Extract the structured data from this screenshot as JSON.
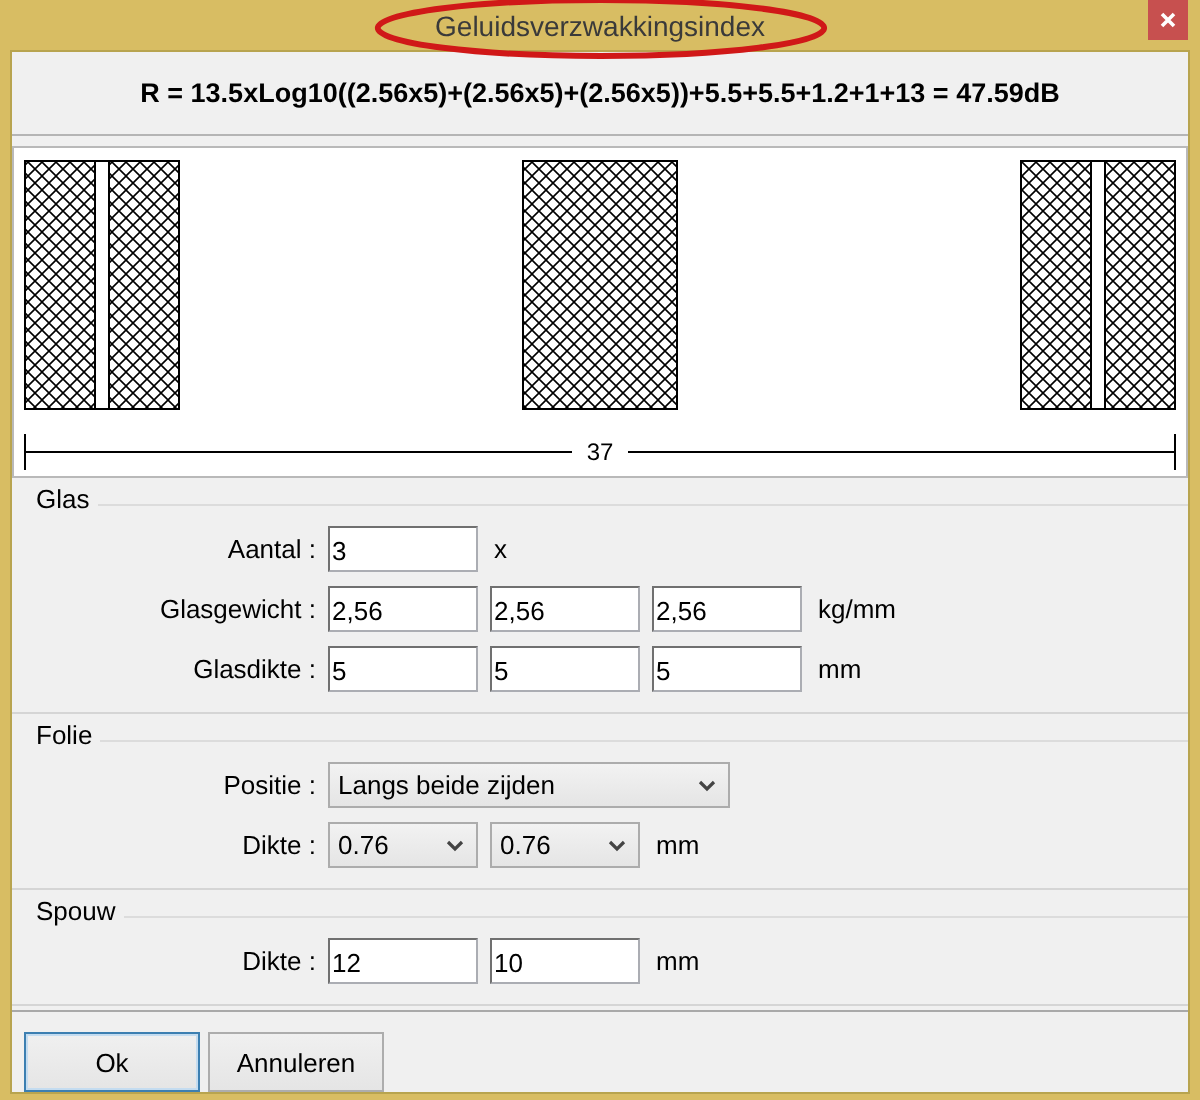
{
  "window": {
    "title": "Geluidsverzwakkingsindex",
    "title_circled": true
  },
  "formula": "R = 13.5xLog10((2.56x5)+(2.56x5)+(2.56x5))+5.5+5.5+1.2+1+13 = 47.59dB",
  "diagram": {
    "panes": [
      {
        "kind": "laminated"
      },
      {
        "kind": "single"
      },
      {
        "kind": "laminated"
      }
    ],
    "dimension": "37"
  },
  "groups": [
    {
      "title": "Glas",
      "rows": [
        {
          "label": "Aantal :",
          "fields": [
            {
              "kind": "input",
              "value": "3"
            }
          ],
          "unit": "x"
        },
        {
          "label": "Glasgewicht :",
          "fields": [
            {
              "kind": "input",
              "value": "2,56"
            },
            {
              "kind": "input",
              "value": "2,56"
            },
            {
              "kind": "input",
              "value": "2,56"
            }
          ],
          "unit": "kg/mm"
        },
        {
          "label": "Glasdikte :",
          "fields": [
            {
              "kind": "input",
              "value": "5"
            },
            {
              "kind": "input",
              "value": "5"
            },
            {
              "kind": "input",
              "value": "5"
            }
          ],
          "unit": "mm"
        }
      ]
    },
    {
      "title": "Folie",
      "rows": [
        {
          "label": "Positie :",
          "fields": [
            {
              "kind": "wide-select",
              "value": "Langs beide zijden"
            }
          ]
        },
        {
          "label": "Dikte :",
          "fields": [
            {
              "kind": "select",
              "value": "0.76"
            },
            {
              "kind": "select",
              "value": "0.76"
            }
          ],
          "unit": "mm"
        }
      ]
    },
    {
      "title": "Spouw",
      "rows": [
        {
          "label": "Dikte :",
          "fields": [
            {
              "kind": "input",
              "value": "12"
            },
            {
              "kind": "input",
              "value": "10"
            }
          ],
          "unit": "mm"
        }
      ]
    }
  ],
  "buttons": [
    {
      "label": "Ok",
      "focused": true
    },
    {
      "label": "Annuleren",
      "focused": false
    }
  ]
}
